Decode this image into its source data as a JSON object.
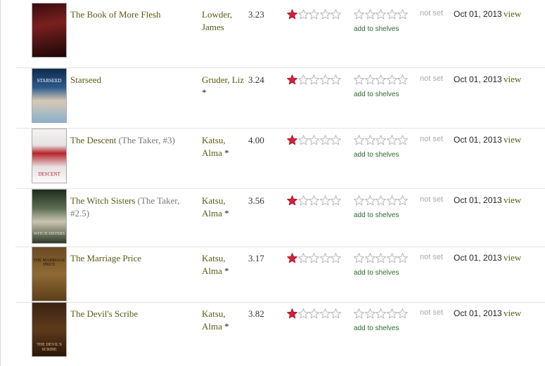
{
  "colors": {
    "link": "#5a5a15",
    "star_filled": "#d4213b",
    "star_empty": "#cccccc",
    "shelves_link": "#2e6b2e",
    "not_set": "#aaaaaa"
  },
  "labels": {
    "add_to_shelves": "add to shelves",
    "not_set": "not set",
    "view": "view"
  },
  "books": [
    {
      "title": "The Book of More Flesh",
      "series": "",
      "author_line1": "Lowder,",
      "author_line2": "James",
      "author_star": "",
      "avg_rating": "3.23",
      "my_rating": 1,
      "date_added": "Oct 01, 2013",
      "cover_text": "",
      "cover_icon": "book-cover-dark-red"
    },
    {
      "title": "Starseed",
      "series": "",
      "author_line1": "Gruder, Liz",
      "author_line2": "",
      "author_star": "*",
      "avg_rating": "3.24",
      "my_rating": 1,
      "date_added": "Oct 01, 2013",
      "cover_text": "STARSEED",
      "cover_icon": "book-cover-blue-couple"
    },
    {
      "title": "The Descent",
      "series": "(The Taker, #3)",
      "author_line1": "Katsu,",
      "author_line2": "Alma",
      "author_star": "*",
      "avg_rating": "4.00",
      "my_rating": 1,
      "date_added": "Oct 01, 2013",
      "cover_text": "DESCENT",
      "cover_icon": "book-cover-red-dress"
    },
    {
      "title": "The Witch Sisters",
      "series": "(The Taker, #2.5)",
      "author_line1": "Katsu,",
      "author_line2": "Alma",
      "author_star": "*",
      "avg_rating": "3.56",
      "my_rating": 1,
      "date_added": "Oct 01, 2013",
      "cover_text": "WITCH SISTERS",
      "cover_icon": "book-cover-green-woman"
    },
    {
      "title": "The Marriage Price",
      "series": "",
      "author_line1": "Katsu,",
      "author_line2": "Alma",
      "author_star": "*",
      "avg_rating": "3.17",
      "my_rating": 1,
      "date_added": "Oct 01, 2013",
      "cover_text": "THE MARRIAGE PRICE",
      "cover_icon": "book-cover-brown-parchment"
    },
    {
      "title": "The Devil's Scribe",
      "series": "",
      "author_line1": "Katsu,",
      "author_line2": "Alma",
      "author_star": "*",
      "avg_rating": "3.82",
      "my_rating": 1,
      "date_added": "Oct 01, 2013",
      "cover_text": "THE DEVIL'S SCRIBE",
      "cover_icon": "book-cover-dark-brown"
    }
  ]
}
